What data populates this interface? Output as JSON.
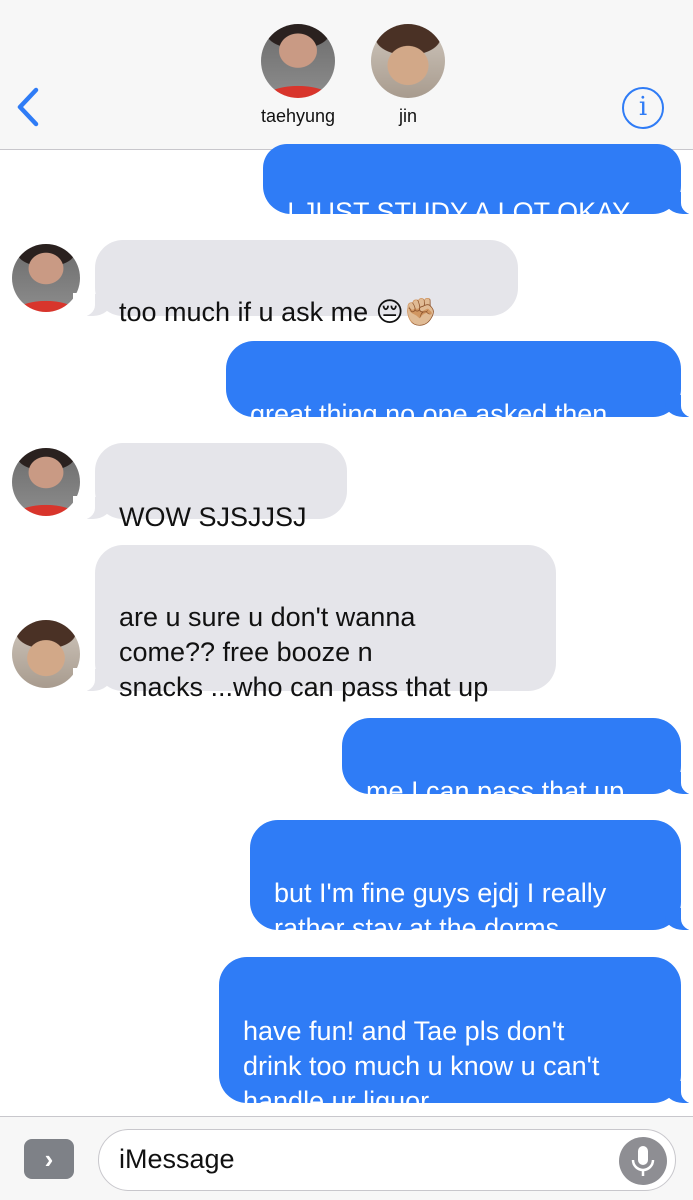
{
  "header": {
    "contacts": [
      {
        "name": "taehyung"
      },
      {
        "name": "jin"
      }
    ],
    "info_glyph": "i",
    "back_icon": "chevron-left-icon"
  },
  "messages": [
    {
      "direction": "out",
      "text": "I JUST STUDY A LOT OKAY"
    },
    {
      "direction": "in",
      "sender": "taehyung",
      "text": "too much if u ask me 😔✊🏼"
    },
    {
      "direction": "out",
      "text": "great thing no one asked then"
    },
    {
      "direction": "in",
      "sender": "taehyung",
      "text": "WOW SJSJJSJ"
    },
    {
      "direction": "in",
      "sender": "jin",
      "text": "are u sure u don't wanna\ncome?? free booze n\nsnacks ...who can pass that up"
    },
    {
      "direction": "out",
      "text": "me I can pass that up"
    },
    {
      "direction": "out",
      "text": "but I'm fine guys ejdj I really\nrather stay at the dorms"
    },
    {
      "direction": "out",
      "text": "have fun! and Tae pls don't\ndrink too much u know u can't\nhandle ur liquor"
    }
  ],
  "input_bar": {
    "placeholder": "iMessage",
    "apps_glyph": "›",
    "mic_icon": "microphone-icon"
  },
  "colors": {
    "outgoing_bubble": "#2f7cf6",
    "incoming_bubble": "#e5e5ea",
    "accent": "#2f7cf6",
    "header_bg": "#f7f7f7"
  }
}
